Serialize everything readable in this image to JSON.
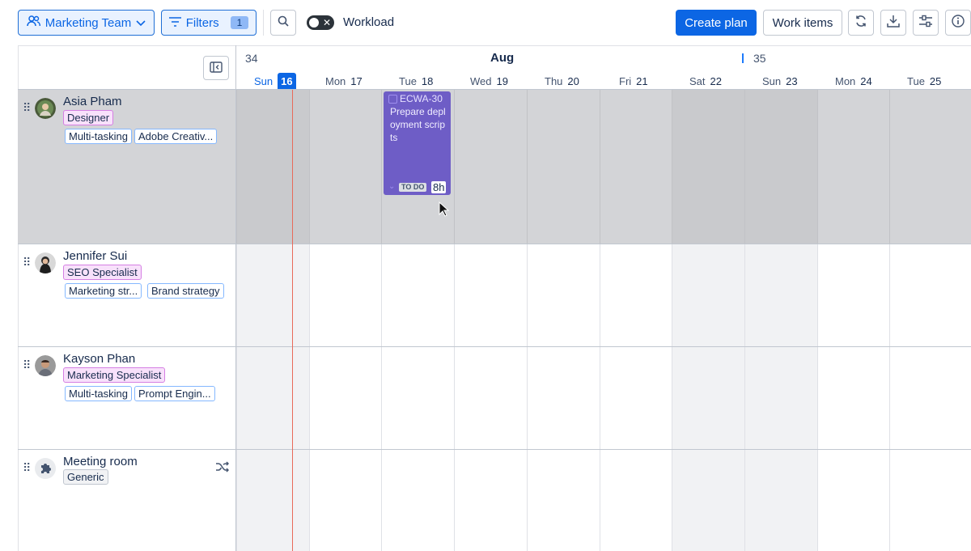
{
  "toolbar": {
    "team_label": "Marketing Team",
    "filters_label": "Filters",
    "filters_count": "1",
    "workload_label": "Workload",
    "create_plan_label": "Create plan",
    "work_items_label": "Work items",
    "icons": [
      "people-icon",
      "chevron-down-icon",
      "filter-icon",
      "search-icon",
      "refresh-icon",
      "download-icon",
      "settings-sliders-icon",
      "info-icon"
    ]
  },
  "timeline": {
    "week_start": "34",
    "week_next": "35",
    "month": "Aug",
    "days": [
      {
        "dow": "Sun",
        "num": "16",
        "today": true,
        "weekend": true
      },
      {
        "dow": "Mon",
        "num": "17",
        "today": false,
        "weekend": false
      },
      {
        "dow": "Tue",
        "num": "18",
        "today": false,
        "weekend": false
      },
      {
        "dow": "Wed",
        "num": "19",
        "today": false,
        "weekend": false
      },
      {
        "dow": "Thu",
        "num": "20",
        "today": false,
        "weekend": false
      },
      {
        "dow": "Fri",
        "num": "21",
        "today": false,
        "weekend": false
      },
      {
        "dow": "Sat",
        "num": "22",
        "today": false,
        "weekend": true
      },
      {
        "dow": "Sun",
        "num": "23",
        "today": false,
        "weekend": true
      },
      {
        "dow": "Mon",
        "num": "24",
        "today": false,
        "weekend": false
      },
      {
        "dow": "Tue",
        "num": "25",
        "today": false,
        "weekend": false
      }
    ]
  },
  "resources": [
    {
      "name": "Asia Pham",
      "role": "Designer",
      "skills": [
        "Multi-tasking",
        "Adobe Creativ..."
      ]
    },
    {
      "name": "Jennifer Sui",
      "role": "SEO Specialist",
      "skills": [
        "Marketing str...",
        "Brand strategy"
      ]
    },
    {
      "name": "Kayson Phan",
      "role": "Marketing Specialist",
      "skills": [
        "Multi-tasking",
        "Prompt Engin..."
      ]
    },
    {
      "name": "Meeting room",
      "tag": "Generic"
    }
  ],
  "task": {
    "key": "ECWA-30",
    "title": "Prepare deployment scripts",
    "status": "TO DO",
    "hours": "8h",
    "color": "#6e5dc6"
  },
  "colors": {
    "accent": "#0c66e4",
    "today_line": "#e86a5a",
    "role_tag_bg": "#f8e1fb",
    "skill_tag_border": "#85b8ff"
  }
}
